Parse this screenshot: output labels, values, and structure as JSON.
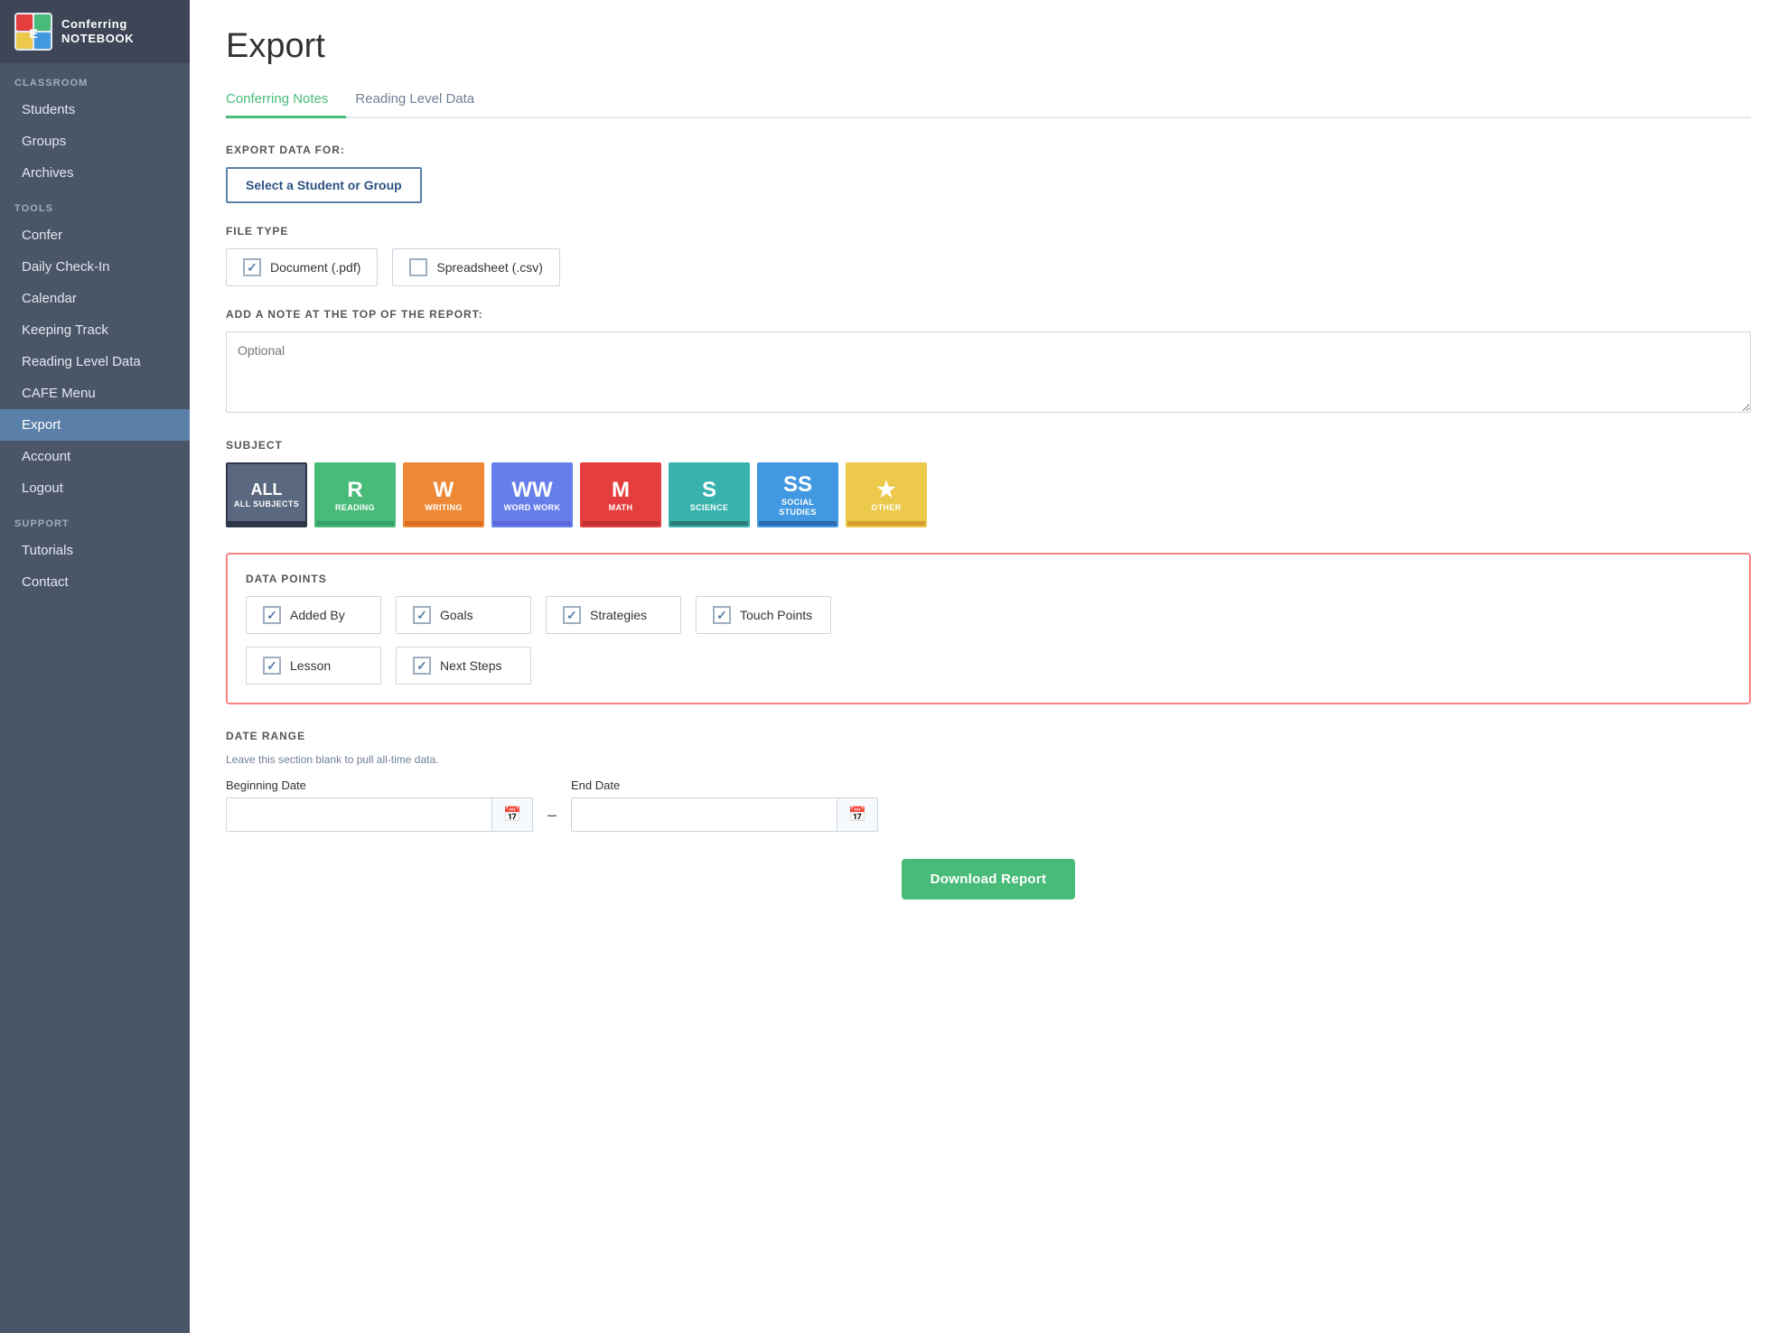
{
  "sidebar": {
    "logo": {
      "title_line1": "Conferring",
      "title_line2": "NOTEBOOK"
    },
    "sections": [
      {
        "label": "CLASSROOM",
        "items": [
          {
            "id": "students",
            "label": "Students",
            "active": false
          },
          {
            "id": "groups",
            "label": "Groups",
            "active": false
          },
          {
            "id": "archives",
            "label": "Archives",
            "active": false
          }
        ]
      },
      {
        "label": "TOOLS",
        "items": [
          {
            "id": "confer",
            "label": "Confer",
            "active": false
          },
          {
            "id": "daily-check-in",
            "label": "Daily Check-In",
            "active": false
          },
          {
            "id": "calendar",
            "label": "Calendar",
            "active": false
          },
          {
            "id": "keeping-track",
            "label": "Keeping Track",
            "active": false
          },
          {
            "id": "reading-level-data",
            "label": "Reading Level Data",
            "active": false
          },
          {
            "id": "cafe-menu",
            "label": "CAFE Menu",
            "active": false
          },
          {
            "id": "export",
            "label": "Export",
            "active": true
          }
        ]
      },
      {
        "label": "",
        "items": [
          {
            "id": "account",
            "label": "Account",
            "active": false
          },
          {
            "id": "logout",
            "label": "Logout",
            "active": false
          }
        ]
      },
      {
        "label": "SUPPORT",
        "items": [
          {
            "id": "tutorials",
            "label": "Tutorials",
            "active": false
          },
          {
            "id": "contact",
            "label": "Contact",
            "active": false
          }
        ]
      }
    ]
  },
  "page": {
    "title": "Export",
    "tabs": [
      {
        "id": "conferring-notes",
        "label": "Conferring Notes",
        "active": true
      },
      {
        "id": "reading-level-data",
        "label": "Reading Level Data",
        "active": false
      }
    ],
    "export_data_for_label": "EXPORT DATA FOR:",
    "select_student_label": "Select a Student or Group",
    "file_type_label": "FILE TYPE",
    "file_types": [
      {
        "id": "pdf",
        "label": "Document (.pdf)",
        "checked": true
      },
      {
        "id": "csv",
        "label": "Spreadsheet (.csv)",
        "checked": false
      }
    ],
    "note_label": "ADD A NOTE AT THE TOP OF THE REPORT:",
    "note_placeholder": "Optional",
    "subject_label": "SUBJECT",
    "subjects": [
      {
        "id": "all",
        "letter": "ALL",
        "name": "ALL SUBJECTS",
        "color": "#5a6880",
        "bar": "#333",
        "active": true
      },
      {
        "id": "reading",
        "letter": "R",
        "name": "READING",
        "color": "#48bb78",
        "bar": "#38a169",
        "active": false
      },
      {
        "id": "writing",
        "letter": "W",
        "name": "WRITING",
        "color": "#ed8936",
        "bar": "#dd6b20",
        "active": false
      },
      {
        "id": "wordwork",
        "letter": "WW",
        "name": "WORD WORK",
        "color": "#667eea",
        "bar": "#5a67d8",
        "active": false
      },
      {
        "id": "math",
        "letter": "M",
        "name": "MATH",
        "color": "#e53e3e",
        "bar": "#c53030",
        "active": false
      },
      {
        "id": "science",
        "letter": "S",
        "name": "SCIENCE",
        "color": "#38b2ac",
        "bar": "#2c7a7b",
        "active": false
      },
      {
        "id": "socialstudies",
        "letter": "SS",
        "name": "SOCIAL\nSTUDIES",
        "color": "#4299e1",
        "bar": "#2b6cb0",
        "active": false
      },
      {
        "id": "other",
        "letter": "★",
        "name": "OTHER",
        "color": "#ecc94b",
        "bar": "#d69e2e",
        "active": false
      }
    ],
    "data_points_label": "DATA POINTS",
    "data_points": [
      {
        "id": "added-by",
        "label": "Added By",
        "checked": true
      },
      {
        "id": "goals",
        "label": "Goals",
        "checked": true
      },
      {
        "id": "strategies",
        "label": "Strategies",
        "checked": true
      },
      {
        "id": "touch-points",
        "label": "Touch Points",
        "checked": true
      },
      {
        "id": "lesson",
        "label": "Lesson",
        "checked": true
      },
      {
        "id": "next-steps",
        "label": "Next Steps",
        "checked": true
      }
    ],
    "date_range_label": "DATE RANGE",
    "date_range_hint": "Leave this section blank to pull all-time data.",
    "beginning_date_label": "Beginning Date",
    "end_date_label": "End Date",
    "date_separator": "–",
    "download_btn_label": "Download Report"
  }
}
